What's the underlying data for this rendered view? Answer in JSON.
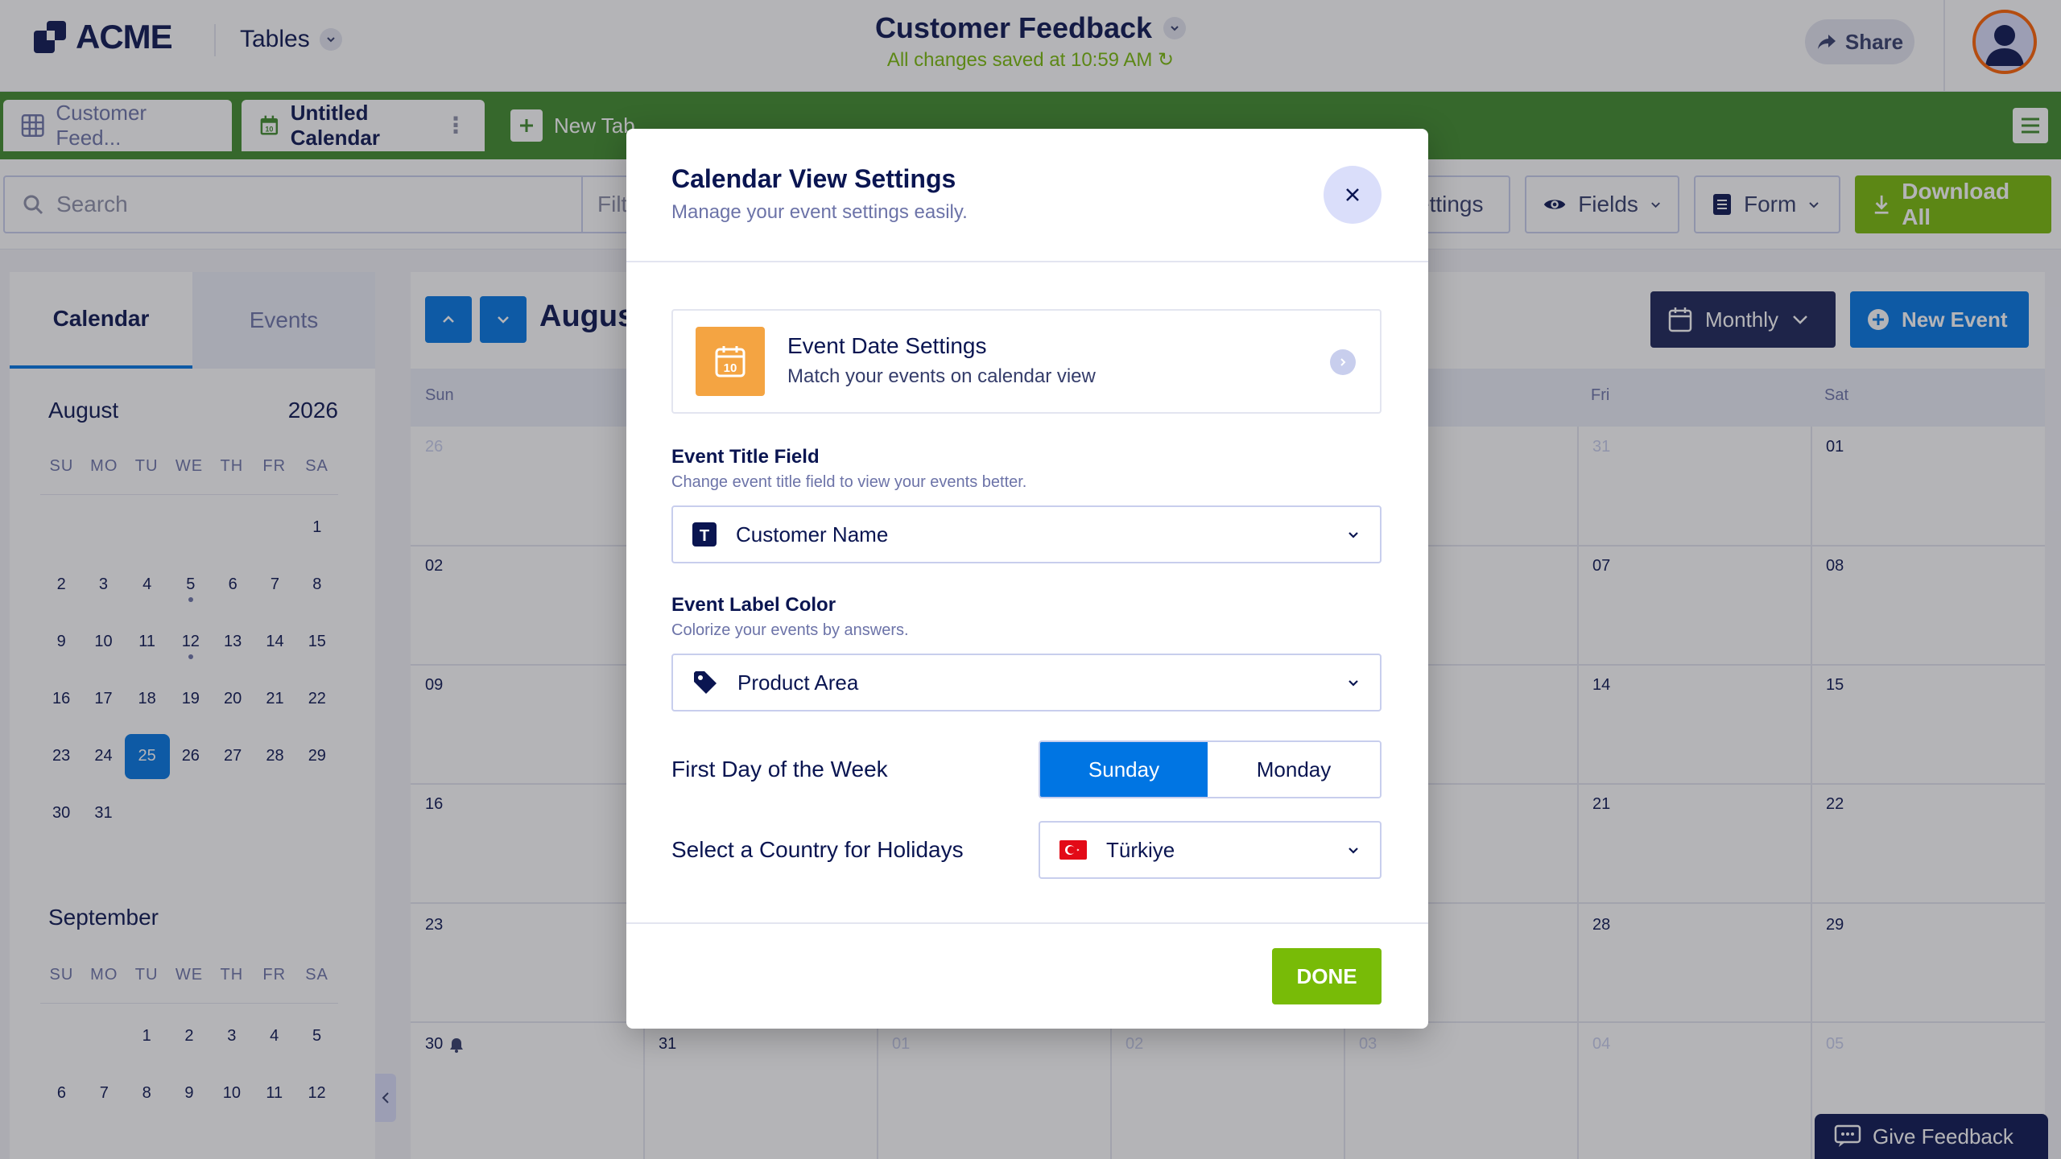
{
  "header": {
    "logo": "ACME",
    "tables_label": "Tables",
    "doc_title": "Customer Feedback",
    "saved_status": "All changes saved at 10:59 AM",
    "share_label": "Share"
  },
  "tabs": [
    {
      "label": "Customer Feed..."
    },
    {
      "label": "Untitled Calendar"
    },
    {
      "label": "New Tab"
    }
  ],
  "toolbar": {
    "search_placeholder": "Search",
    "filter_label": "Filt",
    "settings_label": "ettings",
    "fields_label": "Fields",
    "form_label": "Form",
    "download_label": "Download All"
  },
  "left_panel": {
    "tab_calendar": "Calendar",
    "tab_events": "Events",
    "august": {
      "month": "August",
      "year": "2026"
    },
    "september": {
      "month": "September"
    },
    "dow": [
      "SU",
      "MO",
      "TU",
      "WE",
      "TH",
      "FR",
      "SA"
    ],
    "aug_days": [
      "",
      "",
      "",
      "",
      "",
      "",
      "1",
      "2",
      "3",
      "4",
      "5",
      "6",
      "7",
      "8",
      "9",
      "10",
      "11",
      "12",
      "13",
      "14",
      "15",
      "16",
      "17",
      "18",
      "19",
      "20",
      "21",
      "22",
      "23",
      "24",
      "25",
      "26",
      "27",
      "28",
      "29",
      "30",
      "31"
    ],
    "sep_days": [
      "",
      "",
      "1",
      "2",
      "3",
      "4",
      "5",
      "6",
      "7",
      "8",
      "9",
      "10",
      "11",
      "12"
    ],
    "selected_day": "25"
  },
  "main": {
    "month_title": "August",
    "view_label": "Monthly",
    "new_event_label": "New Event",
    "week_days": [
      "Sun",
      "Fri",
      "Sat"
    ],
    "rows": [
      {
        "sun": "26",
        "fri": "31",
        "sat": "01"
      },
      {
        "sun": "02",
        "fri": "07",
        "sat": "08"
      },
      {
        "sun": "09",
        "fri": "14",
        "sat": "15"
      },
      {
        "sun": "16",
        "fri": "21",
        "sat": "22"
      },
      {
        "sun": "23",
        "fri": "28",
        "sat": "29"
      }
    ],
    "last_row": [
      "30",
      "31",
      "01",
      "02",
      "03",
      "04",
      "05"
    ]
  },
  "feedback_label": "Give Feedback",
  "modal": {
    "title": "Calendar View Settings",
    "subtitle": "Manage your event settings easily.",
    "event_date": {
      "title": "Event Date Settings",
      "subtitle": "Match your events on calendar view",
      "icon_day": "10"
    },
    "title_field": {
      "label": "Event Title Field",
      "help": "Change event title field to view your events better.",
      "value": "Customer Name",
      "icon_letter": "T"
    },
    "label_color": {
      "label": "Event Label Color",
      "help": "Colorize your events by answers.",
      "value": "Product Area"
    },
    "first_day": {
      "label": "First Day of the Week",
      "options": [
        "Sunday",
        "Monday"
      ],
      "selected": "Sunday"
    },
    "holidays": {
      "label": "Select a Country for Holidays",
      "value": "Türkiye"
    },
    "done_label": "DONE"
  },
  "colors": {
    "primary": "#0075e3",
    "green": "#78bb07",
    "tabbar": "#3e8a2a",
    "navy": "#0a1551",
    "orange": "#f4a442"
  }
}
